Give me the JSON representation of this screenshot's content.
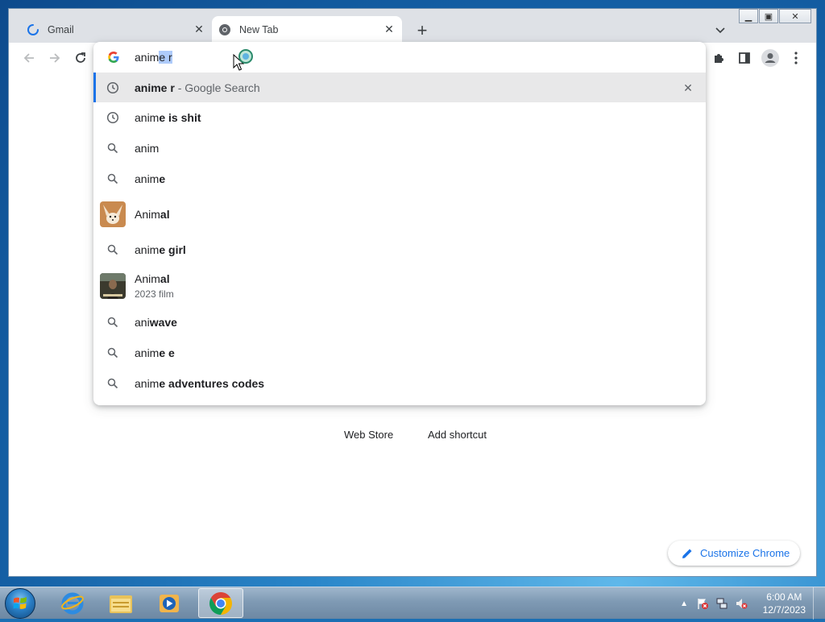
{
  "browser": {
    "tabs": [
      {
        "title": "Gmail",
        "icon": "loading-spinner-icon",
        "active": false
      },
      {
        "title": "New Tab",
        "icon": "chrome-icon",
        "active": true
      }
    ],
    "new_tab_label": "+",
    "tab_search_icon": "chevron-down-icon",
    "window_controls": [
      "minimize",
      "maximize",
      "close"
    ]
  },
  "toolbar": {
    "back_icon": "arrow-left-icon",
    "forward_icon": "arrow-right-icon",
    "reload_icon": "reload-icon",
    "extensions_icon": "puzzle-icon",
    "sidepanel_icon": "side-panel-icon",
    "profile_icon": "avatar-icon",
    "menu_icon": "kebab-menu-icon"
  },
  "omnibox": {
    "typed": "anim",
    "autocomplete": "e r",
    "suggestions": [
      {
        "type": "history",
        "parts": [
          {
            "t": "anime r",
            "b": true
          },
          {
            "t": " - Google Search",
            "dim": true
          }
        ],
        "selected": true
      },
      {
        "type": "history",
        "parts": [
          {
            "t": "anim",
            "b": false
          },
          {
            "t": "e is shit",
            "b": true
          }
        ]
      },
      {
        "type": "search",
        "parts": [
          {
            "t": "anim",
            "b": false
          }
        ]
      },
      {
        "type": "search",
        "parts": [
          {
            "t": "anim",
            "b": false
          },
          {
            "t": "e",
            "b": true
          }
        ]
      },
      {
        "type": "entity",
        "thumb": "fox",
        "parts": [
          {
            "t": "Anim",
            "b": false
          },
          {
            "t": "al",
            "b": true
          }
        ]
      },
      {
        "type": "search",
        "parts": [
          {
            "t": "anim",
            "b": false
          },
          {
            "t": "e girl",
            "b": true
          }
        ]
      },
      {
        "type": "entity",
        "thumb": "film",
        "parts": [
          {
            "t": "Anim",
            "b": false
          },
          {
            "t": "al",
            "b": true
          }
        ],
        "sub": "2023 film"
      },
      {
        "type": "search",
        "parts": [
          {
            "t": "ani",
            "b": false
          },
          {
            "t": "wave",
            "b": true
          }
        ]
      },
      {
        "type": "search",
        "parts": [
          {
            "t": "anim",
            "b": false
          },
          {
            "t": "e e",
            "b": true
          }
        ]
      },
      {
        "type": "search",
        "parts": [
          {
            "t": "anim",
            "b": false
          },
          {
            "t": "e adventures codes",
            "b": true
          }
        ]
      }
    ]
  },
  "ntp": {
    "shortcuts": [
      "Web Store",
      "Add shortcut"
    ],
    "customize_label": "Customize Chrome"
  },
  "taskbar": {
    "apps": [
      "internet-explorer-icon",
      "windows-explorer-icon",
      "media-player-icon",
      "chrome-icon"
    ],
    "clock_time": "6:00 AM",
    "clock_date": "12/7/2023"
  }
}
